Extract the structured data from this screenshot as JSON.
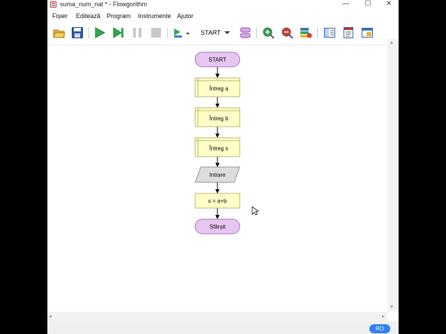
{
  "window": {
    "title": "suma_num_nat * - Flowgorithm",
    "controls": {
      "minimize": "—",
      "maximize": "☐",
      "close": "✕"
    }
  },
  "menu": [
    "Fișier",
    "Editează",
    "Program",
    "Instrumente",
    "Ajutor"
  ],
  "toolbar": {
    "buttons": [
      "open-folder-icon",
      "save-icon",
      "run-icon",
      "step-icon",
      "pause-icon",
      "stop-icon",
      "run-to-icon"
    ],
    "function_select": "START",
    "more_buttons": [
      "layout-icon",
      "zoom-in-icon",
      "zoom-out-icon",
      "add-shape-icon",
      "panel-left-icon",
      "panel-code-icon",
      "panel-console-icon"
    ]
  },
  "flowchart": {
    "start_label": "START",
    "nodes": [
      {
        "type": "declare",
        "text": "Întreg a"
      },
      {
        "type": "declare",
        "text": "Întreg b"
      },
      {
        "type": "declare",
        "text": "Întreg s"
      },
      {
        "type": "input",
        "text": "Intrare"
      },
      {
        "type": "assign",
        "text": "s = a+b"
      }
    ],
    "end_label": "Sfârșit",
    "colors": {
      "terminal_fill": "#e8c6f2",
      "terminal_stroke": "#a070b8",
      "declare_fill": "#ffffc8",
      "declare_stroke": "#b4b470",
      "input_fill": "#dddddd",
      "input_stroke": "#909090"
    }
  },
  "status": {
    "language": "RO"
  }
}
